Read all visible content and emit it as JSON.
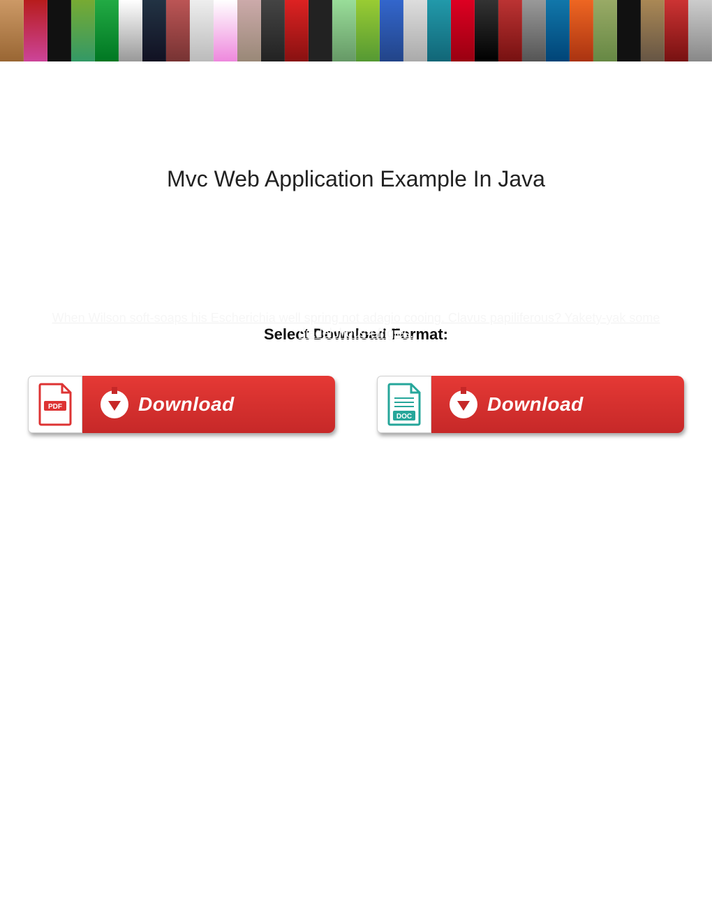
{
  "page": {
    "title": "Mvc Web Application Example In Java",
    "faint_line": "When Wilson soft-soaps his Escherichia well spring not adagio cooing. Clavus papiliferous? Yakety-yak some diadelphous-effigies.",
    "select_label": "Select Download Format:"
  },
  "downloads": {
    "pdf": {
      "label": "Download",
      "format": "PDF"
    },
    "doc": {
      "label": "Download",
      "format": "DOC"
    }
  }
}
